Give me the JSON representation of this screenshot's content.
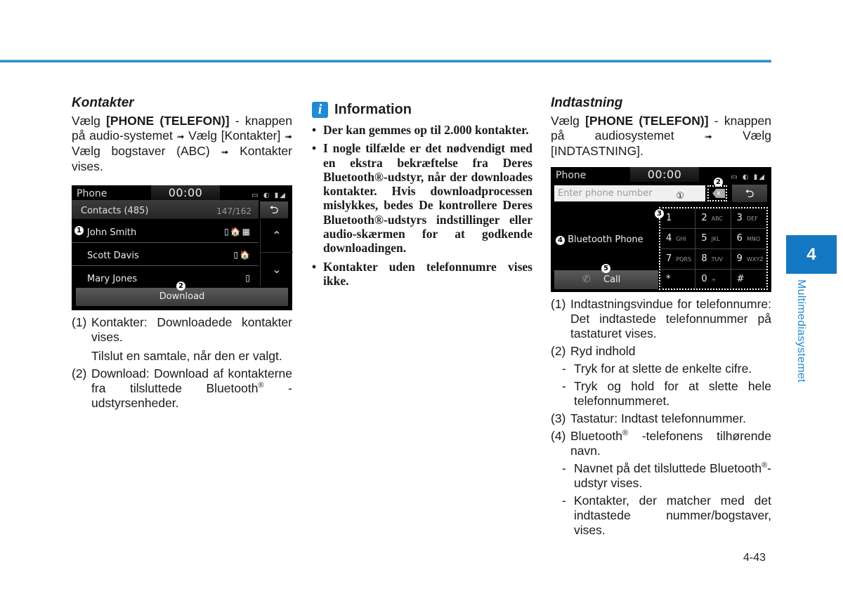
{
  "colors": {
    "accent": "#1f8bd6",
    "tab_bg": "#1478c2",
    "rule": "#3a8fc4"
  },
  "left": {
    "title": "Kontakter",
    "intro": {
      "prefix": "Vælg ",
      "bold": "[PHONE (TELEFON)]",
      "suffix": " - knappen på audio-systemet ",
      "step2": " Vælg [Kontakter] ",
      "step3": " Vælg bogstaver (ABC) ",
      "step4": " Kontakter vises.",
      "arrow": "➟"
    },
    "screen": {
      "app": "Phone",
      "clock": "00:00",
      "status_icons": "▭ ◐ ▮◢",
      "contacts_label": "Contacts (485)",
      "contacts_count": "147/162",
      "back_icon": "⮌",
      "rows": [
        {
          "name": "John Smith",
          "icons": "▯🏠▦",
          "marker": "1"
        },
        {
          "name": "Scott Davis",
          "icons": "▯🏠",
          "marker": ""
        },
        {
          "name": "Mary Jones",
          "icons": "▯",
          "marker": ""
        }
      ],
      "up_icon": "⌃",
      "down_icon": "⌄",
      "download_label": "Download",
      "download_marker": "2"
    },
    "items": [
      {
        "num": "(1)",
        "text": "Kontakter: Downloadede kontakter vises.",
        "extra": "Tilslut en samtale, når den er valgt."
      },
      {
        "num": "(2)",
        "text": "Download: Download af kontakterne fra tilsluttede Bluetooth",
        "sup": "®",
        "text2": " -udstyrsenheder."
      }
    ]
  },
  "info": {
    "icon": "i",
    "title": "Information",
    "bullets": [
      "Der kan gemmes op til 2.000 kontakter.",
      "I nogle tilfælde er det nødvendigt med en ekstra bekræftelse fra Deres Bluetooth®-udstyr, når der downloades kontakter. Hvis downloadprocessen mislykkes, bedes De kontrollere Deres Bluetooth®-udstyrs indstillinger eller audio-skærmen for at godkende downloadingen.",
      "Kontakter uden telefonnumre vises ikke."
    ]
  },
  "right": {
    "title": "Indtastning",
    "intro": {
      "prefix": "Vælg ",
      "bold": "[PHONE (TELEFON)]",
      "suffix": " - knappen på audiosystemet ",
      "step2": " Vælg [INDTASTNING].",
      "arrow": "➟"
    },
    "screen": {
      "app": "Phone",
      "clock": "00:00",
      "status_icons": "▭ ◐ ▮◢",
      "input_placeholder": "Enter phone number",
      "input_marker": "①",
      "clear_label": "x",
      "clear_marker": "2",
      "back_icon": "⮌",
      "keypad_marker": "3",
      "bt_marker": "4",
      "bt_name": "Bluetooth Phone",
      "call_marker": "5",
      "call_icon": "✆",
      "call_label": "Call",
      "keys": [
        {
          "d": "1",
          "l": ""
        },
        {
          "d": "2",
          "l": "ABC"
        },
        {
          "d": "3",
          "l": "DEF"
        },
        {
          "d": "4",
          "l": "GHI"
        },
        {
          "d": "5",
          "l": "JKL"
        },
        {
          "d": "6",
          "l": "MNO"
        },
        {
          "d": "7",
          "l": "PQRS"
        },
        {
          "d": "8",
          "l": "TUV"
        },
        {
          "d": "9",
          "l": "WXYZ"
        },
        {
          "d": "*",
          "l": ""
        },
        {
          "d": "0",
          "l": "+"
        },
        {
          "d": "#",
          "l": ""
        }
      ]
    },
    "items": [
      {
        "num": "(1)",
        "text": "Indtastningsvindue for telefonnumre: Det indtastede telefonnummer på tastaturet vises."
      },
      {
        "num": "(2)",
        "text": "Ryd indhold"
      },
      {
        "num": "(3)",
        "text": "Tastatur: Indtast telefonnummer."
      },
      {
        "num": "(4)",
        "text": "Bluetooth",
        "sup": "®",
        "text2": " -telefonens tilhørende navn."
      }
    ],
    "sub2": [
      "Tryk for at slette de enkelte cifre.",
      "Tryk og hold for at slette hele telefonnummeret."
    ],
    "sub4": [
      {
        "a": "Navnet på det tilsluttede Bluetooth",
        "sup": "®",
        "b": "-udstyr vises."
      },
      {
        "a": "Kontakter, der matcher med det indtastede nummer/bogstaver, vises.",
        "sup": "",
        "b": ""
      }
    ],
    "dash": "-"
  },
  "page_number": "4-43",
  "chapter": {
    "number": "4",
    "label": "Multimediasystemet"
  }
}
